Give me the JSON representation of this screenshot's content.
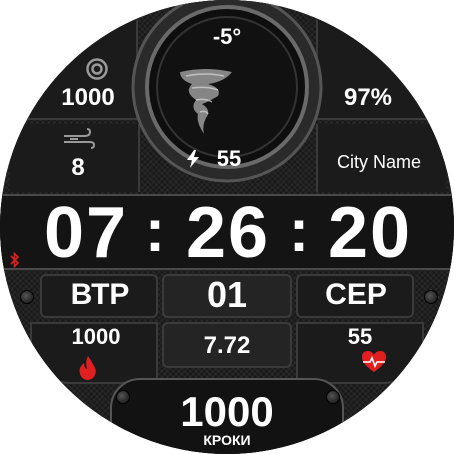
{
  "top_gauge": {
    "temperature": "-5°",
    "weather_icon": "tornado-icon",
    "charge": "55",
    "charge_icon": "lightning-bolt-icon"
  },
  "left_upper": {
    "value": "1000",
    "icon": "target-icon"
  },
  "right_upper": {
    "value": "97%"
  },
  "left_middle": {
    "value": "8",
    "icon": "wind-icon"
  },
  "city": "City Name",
  "time": {
    "hours": "07",
    "minutes": "26",
    "seconds": "20",
    "separator": ":"
  },
  "date": {
    "weekday": "ВТР",
    "day": "01",
    "month": "СЕР"
  },
  "lower_row": {
    "left_value": "1000",
    "center_value": "7.72",
    "right_value": "55"
  },
  "steps": {
    "value": "1000",
    "label": "КРОКИ"
  },
  "colors": {
    "accent_red": "#e02020",
    "text": "#ffffff",
    "panel": "#1b1b1b",
    "bezel": "#3a3a3a"
  },
  "icons": {
    "bluetooth": "bluetooth-icon",
    "flame": "flame-icon",
    "heart": "heart-rate-icon"
  }
}
